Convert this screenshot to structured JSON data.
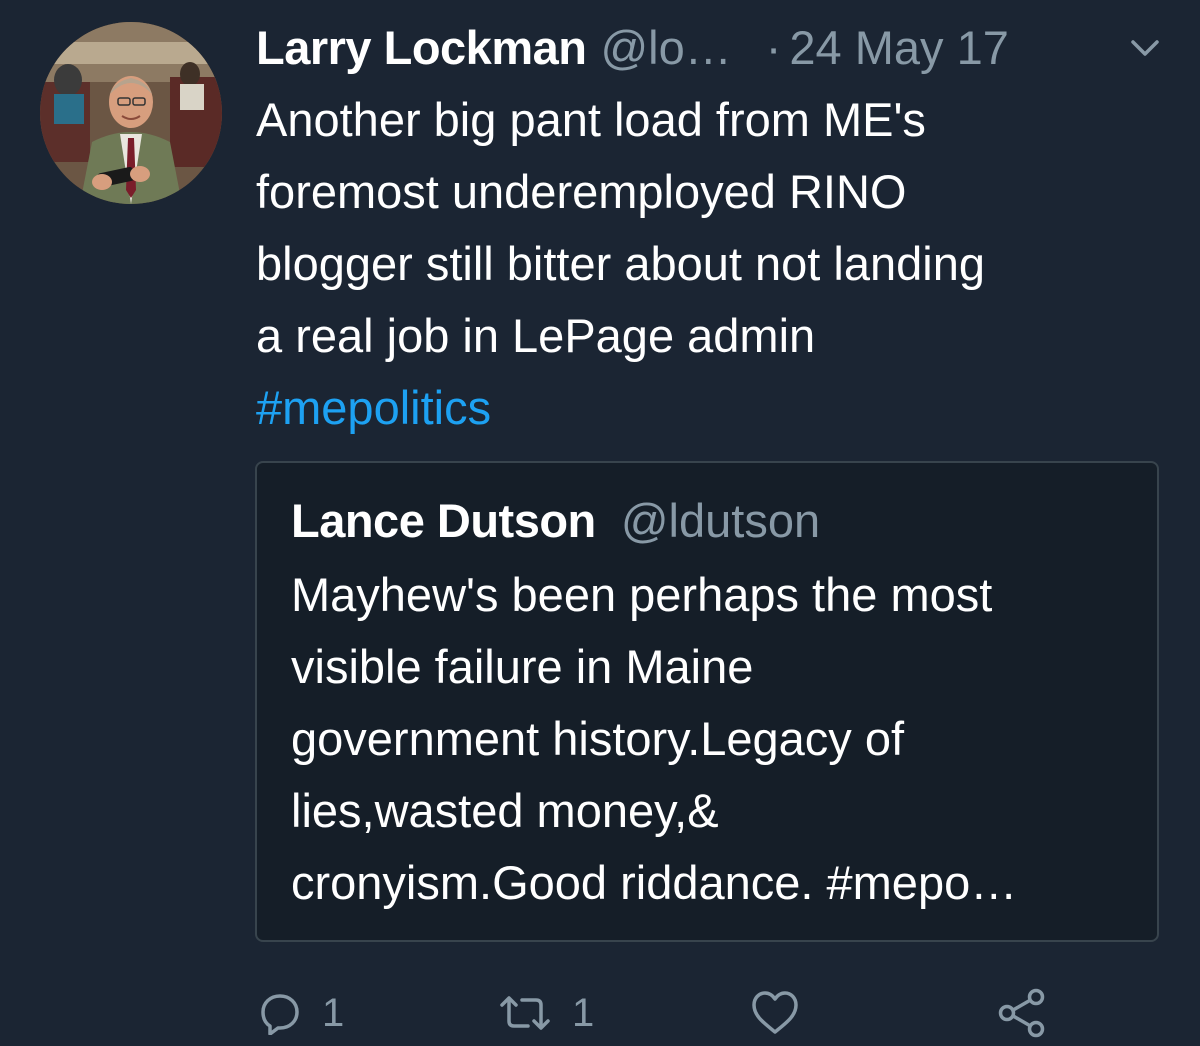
{
  "tweet": {
    "author": {
      "display_name": "Larry Lockman",
      "handle": "@lo…",
      "avatar_icon": "profile-photo"
    },
    "separator": "·",
    "date": "24 May 17",
    "menu_icon": "chevron-down-icon",
    "text_lines": [
      "Another big pant load from ME's",
      "foremost underemployed RINO",
      "blogger still bitter about not landing",
      "a real job in LePage admin"
    ],
    "hashtag": "#mepolitics",
    "quoted": {
      "display_name": "Lance Dutson",
      "handle": "@ldutson",
      "text_lines": [
        "Mayhew's been perhaps the most",
        "visible failure in Maine",
        "government history.Legacy of",
        "lies,wasted money,&",
        "cronyism.Good riddance. #mepo…"
      ]
    },
    "actions": {
      "reply_count": "1",
      "retweet_count": "1",
      "reply_icon": "reply-icon",
      "retweet_icon": "retweet-icon",
      "like_icon": "heart-icon",
      "share_icon": "share-icon"
    }
  },
  "colors": {
    "background": "#1b2533",
    "text": "#ffffff",
    "muted": "#8899a6",
    "link": "#1da1f2",
    "quote_border": "#38444d"
  }
}
